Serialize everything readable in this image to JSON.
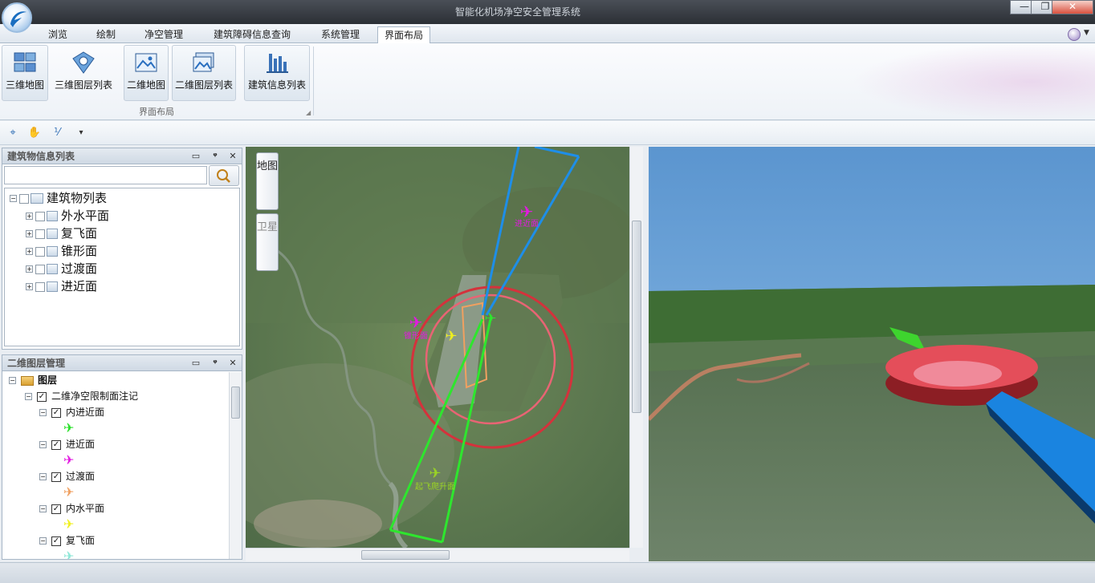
{
  "app": {
    "title": "智能化机场净空安全管理系统",
    "window_buttons": {
      "minimize": "—",
      "maximize": "❐",
      "close": "✕"
    }
  },
  "tabs": [
    {
      "label": "浏览"
    },
    {
      "label": "绘制"
    },
    {
      "label": "净空管理"
    },
    {
      "label": "建筑障碍信息查询"
    },
    {
      "label": "系统管理"
    },
    {
      "label": "界面布局",
      "active": true
    }
  ],
  "ribbon": {
    "group_label": "界面布局",
    "buttons": [
      {
        "label": "三维地图",
        "icon": "globe-3d-icon"
      },
      {
        "label": "三维图层列表",
        "icon": "layers-3d-icon"
      },
      {
        "label": "二维地图",
        "icon": "map-2d-icon"
      },
      {
        "label": "二维图层列表",
        "icon": "layers-2d-icon"
      },
      {
        "label": "建筑信息列表",
        "icon": "building-list-icon"
      }
    ]
  },
  "toolbar": {
    "icons": [
      "locate-icon",
      "pan-hand-icon",
      "measure-icon",
      "dropdown-icon"
    ],
    "glyphs": [
      "⌖",
      "✋",
      "⅟",
      "▾"
    ]
  },
  "building_panel": {
    "title": "建筑物信息列表",
    "search_placeholder": "",
    "buttons": {
      "restore": "▭",
      "pin": "ᵠ",
      "close": "✕"
    },
    "tree_root": "建筑物列表",
    "tree_items": [
      "外水平面",
      "复飞面",
      "锥形面",
      "过渡面",
      "进近面"
    ]
  },
  "layer_panel": {
    "title": "二维图层管理",
    "root": "图层",
    "group": "二维净空限制面注记",
    "items": [
      {
        "label": "内进近面",
        "color": "#28e028"
      },
      {
        "label": "进近面",
        "color": "#e21ae0"
      },
      {
        "label": "过渡面",
        "color": "#f0a060"
      },
      {
        "label": "内水平面",
        "color": "#f0f01e"
      },
      {
        "label": "复飞面",
        "color": "#8fe8d8"
      }
    ]
  },
  "map2d": {
    "side_tabs": [
      "地图",
      "卫星"
    ],
    "labels": [
      "进近面",
      "锥形面",
      "起飞爬升面"
    ],
    "label_colors": {
      "进近面": "#e21ae0",
      "锥形面": "#e21ae0",
      "起飞爬升面": "#9ad424"
    }
  },
  "colors": {
    "approach_blue": "#1e8ee8",
    "takeoff_green": "#2ee62e",
    "conical_red": "#d4323c",
    "inner_pink": "#e86474"
  }
}
